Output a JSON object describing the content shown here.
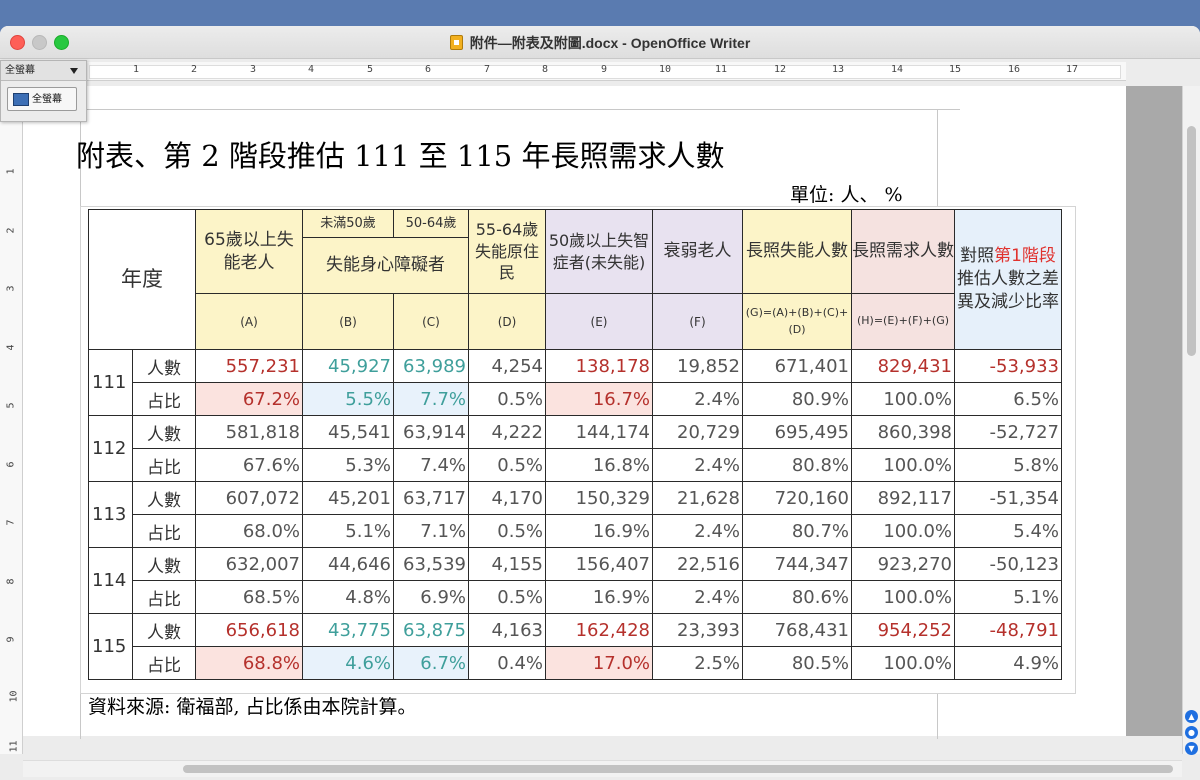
{
  "window": {
    "title": "附件—附表及附圖.docx - OpenOffice Writer"
  },
  "fullscreen_toolbar": {
    "label": "全螢幕",
    "button_label": "全螢幕"
  },
  "ruler": {
    "h_numbers": [
      "1",
      "2",
      "3",
      "4",
      "5",
      "6",
      "7",
      "8",
      "9",
      "10",
      "11",
      "12",
      "13",
      "14",
      "15",
      "16",
      "17"
    ],
    "v_numbers": [
      "1",
      "2",
      "3",
      "4",
      "5",
      "6",
      "7",
      "8",
      "9",
      "10",
      "11"
    ]
  },
  "document": {
    "title": "附表、第 2 階段推估 111 至 115 年長照需求人數",
    "unit": "單位:  人、 %",
    "source": "資料來源:  衛福部,  占比係由本院計算。",
    "table": {
      "year_header": "年度",
      "col_a": "65歲以上失能老人",
      "col_bc_b_top": "未滿50歲",
      "col_bc_c_top": "50-64歲",
      "col_bc_bottom": "失能身心障礙者",
      "col_d": "55-64歲失能原住民",
      "col_e": "50歲以上失智症者(未失能)",
      "col_f": "衰弱老人",
      "col_g": "長照失能人數",
      "col_h": "長照需求人數",
      "col_i_pre": "對照",
      "col_i_red": "第1階段",
      "col_i_post": "推估人數之差異及減少比率",
      "codes": [
        "(A)",
        "(B)",
        "(C)",
        "(D)",
        "(E)",
        "(F)",
        "(G)=(A)+(B)+(C)+(D)",
        "(H)=(E)+(F)+(G)"
      ],
      "row_label_count": "人數",
      "row_label_share": "占比",
      "rows": [
        {
          "year": "111",
          "count": [
            "557,231",
            "45,927",
            "63,989",
            "4,254",
            "138,178",
            "19,852",
            "671,401",
            "829,431",
            "-53,933"
          ],
          "share": [
            "67.2%",
            "5.5%",
            "7.7%",
            "0.5%",
            "16.7%",
            "2.4%",
            "80.9%",
            "100.0%",
            "6.5%"
          ]
        },
        {
          "year": "112",
          "count": [
            "581,818",
            "45,541",
            "63,914",
            "4,222",
            "144,174",
            "20,729",
            "695,495",
            "860,398",
            "-52,727"
          ],
          "share": [
            "67.6%",
            "5.3%",
            "7.4%",
            "0.5%",
            "16.8%",
            "2.4%",
            "80.8%",
            "100.0%",
            "5.8%"
          ]
        },
        {
          "year": "113",
          "count": [
            "607,072",
            "45,201",
            "63,717",
            "4,170",
            "150,329",
            "21,628",
            "720,160",
            "892,117",
            "-51,354"
          ],
          "share": [
            "68.0%",
            "5.1%",
            "7.1%",
            "0.5%",
            "16.9%",
            "2.4%",
            "80.7%",
            "100.0%",
            "5.4%"
          ]
        },
        {
          "year": "114",
          "count": [
            "632,007",
            "44,646",
            "63,539",
            "4,155",
            "156,407",
            "22,516",
            "744,347",
            "923,270",
            "-50,123"
          ],
          "share": [
            "68.5%",
            "4.8%",
            "6.9%",
            "0.5%",
            "16.9%",
            "2.4%",
            "80.6%",
            "100.0%",
            "5.1%"
          ]
        },
        {
          "year": "115",
          "count": [
            "656,618",
            "43,775",
            "63,875",
            "4,163",
            "162,428",
            "23,393",
            "768,431",
            "954,252",
            "-48,791"
          ],
          "share": [
            "68.8%",
            "4.6%",
            "6.7%",
            "0.4%",
            "17.0%",
            "2.5%",
            "80.5%",
            "100.0%",
            "4.9%"
          ]
        }
      ]
    }
  },
  "colors": {
    "highlight_red": "#b5312c",
    "highlight_teal": "#3f9f9b",
    "header_yellow": "#fcf4c8",
    "header_purple": "#e8e2f0",
    "header_pink": "#f5e2e0",
    "header_blue": "#e6f0fa"
  }
}
